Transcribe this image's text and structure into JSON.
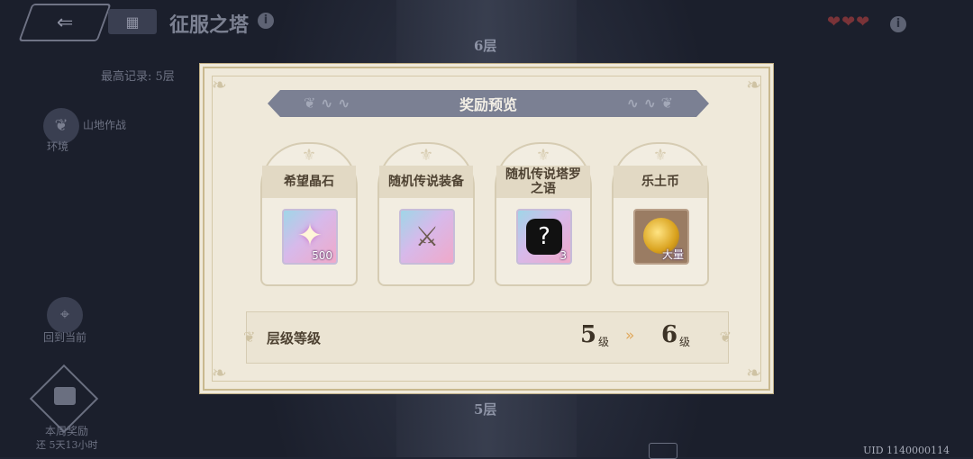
{
  "header": {
    "back_icon": "back-arrow-icon",
    "menu_icon": "grid-icon",
    "title": "征服之塔",
    "hearts": "❤❤❤"
  },
  "background": {
    "record": "最高记录: 5层",
    "floor_top": "6层",
    "floor_bottom": "5层",
    "side_items": [
      {
        "label": "山地作战",
        "sub": "环境"
      },
      {
        "label": "回到当前"
      },
      {
        "label": "本周奖励",
        "sub": "还 5天13小时"
      }
    ],
    "uid": "UID 1140000114"
  },
  "modal": {
    "title": "奖励预览",
    "rewards": [
      {
        "name": "希望晶石",
        "icon": "star-crystal-icon",
        "count": "500",
        "style": "rare"
      },
      {
        "name": "随机传说装备",
        "icon": "question-weapon-icon",
        "count": "",
        "style": "rare"
      },
      {
        "name": "随机传说塔罗之语",
        "icon": "question-tarot-icon",
        "count": "3",
        "style": "rare"
      },
      {
        "name": "乐土币",
        "icon": "gold-coin-icon",
        "count": "大量",
        "style": "gold"
      }
    ],
    "level": {
      "label": "层级等级",
      "from": "5",
      "to": "6",
      "unit": "级"
    }
  },
  "colors": {
    "banner": "#7b8093",
    "panel": "#efe9da",
    "accent_arrow": "#e0a85c"
  }
}
